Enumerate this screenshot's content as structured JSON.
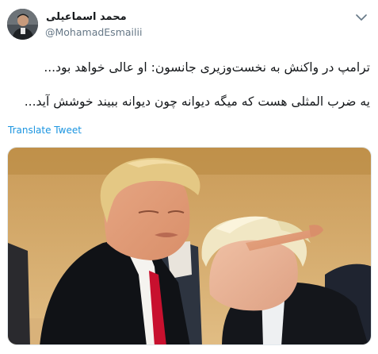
{
  "tweet": {
    "author": {
      "name": "محمد اسماعیلی",
      "handle": "@MohamadEsmailii"
    },
    "text_line1": "ترامپ در واکنش به نخست‌وزیری جانسون: او عالی خواهد بود...",
    "text_line2": "یه ضرب المثلی هست که میگه دیوانه چون دیوانه ببیند خوشش آید...",
    "translate_label": "Translate Tweet",
    "menu_icon": "chevron-down-icon",
    "media_description_icon": "photo"
  },
  "colors": {
    "link": "#1b95e0",
    "secondary_text": "#657786",
    "primary_text": "#14171a"
  }
}
